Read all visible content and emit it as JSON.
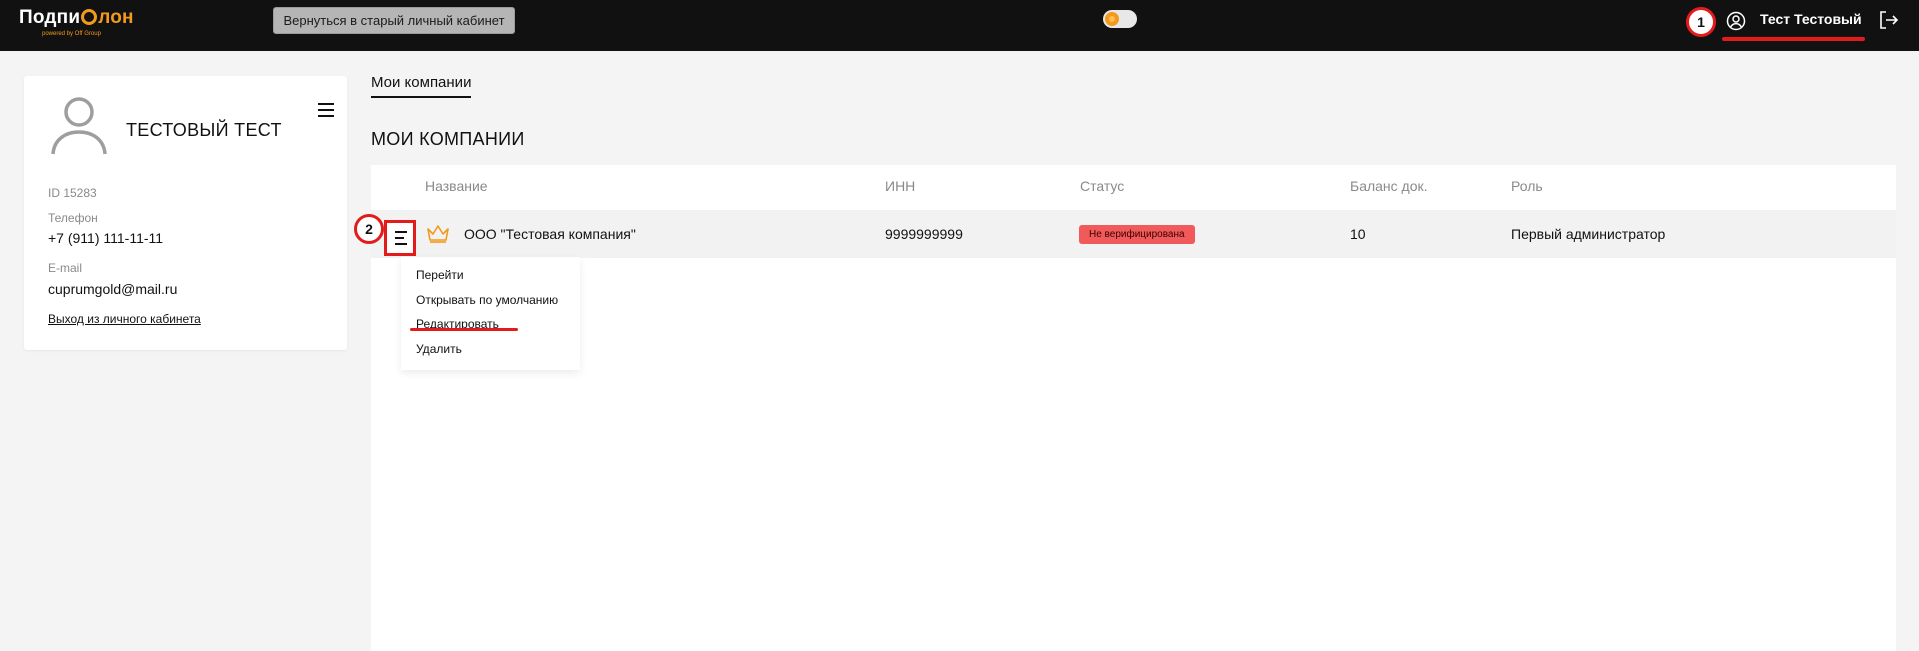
{
  "header": {
    "logo_text_part1": "Подпи",
    "logo_text_part2": "лон",
    "logo_subtext": "powered by Off Group",
    "back_button_label": "Вернуться в старый личный кабинет",
    "user_name": "Тест Тестовый",
    "marker1": "1",
    "accent_color": "#f19a1c"
  },
  "profile": {
    "name": "ТЕСТОВЫЙ ТЕСТ",
    "id_text": "ID 15283",
    "phone_label": "Телефон",
    "phone": "+7 (911) 111-11-11",
    "email_label": "E-mail",
    "email": "cuprumgold@mail.ru",
    "logout_link": "Выход из личного кабинета"
  },
  "main": {
    "tab_label": "Мои компании",
    "section_title": "МОИ КОМПАНИИ",
    "columns": [
      "Название",
      "ИНН",
      "Статус",
      "Баланс док.",
      "Роль"
    ],
    "rows": [
      {
        "name": "ООО \"Тестовая компания\"",
        "inn": "9999999999",
        "status": "Не верифицирована",
        "balance": "10",
        "role": "Первый администратор",
        "status_color": "#f05a5a",
        "icon": "crown-icon"
      }
    ],
    "marker2": "2",
    "row_menu": [
      "Перейти",
      "Открывать по умолчанию",
      "Редактировать",
      "Удалить"
    ]
  },
  "annotation_color": "#e41b1b"
}
